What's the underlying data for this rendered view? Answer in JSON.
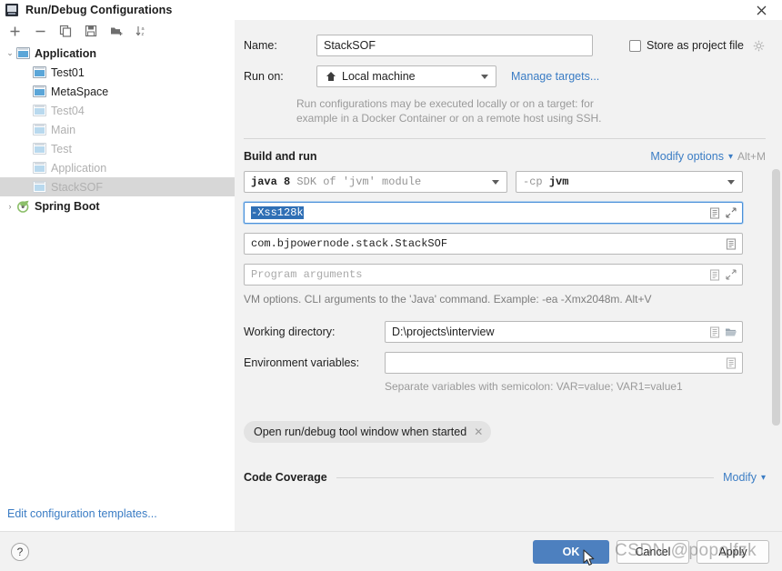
{
  "window": {
    "title": "Run/Debug Configurations",
    "app_icon": "intellij-idea-icon",
    "close_label": "✕"
  },
  "toolbar": {
    "add_label": "+",
    "remove_label": "−",
    "copy_label": "copy-configuration",
    "save_label": "save-configuration",
    "folder_label": "new-folder",
    "sort_label": "sort-configurations"
  },
  "tree": {
    "items": [
      {
        "label": "Application",
        "level": 0,
        "bold": true,
        "dim": false,
        "twisty": "⌄",
        "icon": "application-icon",
        "selected": false
      },
      {
        "label": "Test01",
        "level": 1,
        "bold": false,
        "dim": false,
        "twisty": "",
        "icon": "application-icon",
        "selected": false
      },
      {
        "label": "MetaSpace",
        "level": 1,
        "bold": false,
        "dim": false,
        "twisty": "",
        "icon": "application-icon",
        "selected": false
      },
      {
        "label": "Test04",
        "level": 1,
        "bold": false,
        "dim": true,
        "twisty": "",
        "icon": "application-icon",
        "selected": false
      },
      {
        "label": "Main",
        "level": 1,
        "bold": false,
        "dim": true,
        "twisty": "",
        "icon": "application-icon",
        "selected": false
      },
      {
        "label": "Test",
        "level": 1,
        "bold": false,
        "dim": true,
        "twisty": "",
        "icon": "application-icon",
        "selected": false
      },
      {
        "label": "Application",
        "level": 1,
        "bold": false,
        "dim": true,
        "twisty": "",
        "icon": "application-icon",
        "selected": false
      },
      {
        "label": "StackSOF",
        "level": 1,
        "bold": false,
        "dim": true,
        "twisty": "",
        "icon": "application-icon",
        "selected": true
      },
      {
        "label": "Spring Boot",
        "level": 0,
        "bold": true,
        "dim": false,
        "twisty": "›",
        "icon": "spring-boot-icon",
        "selected": false
      }
    ],
    "edit_templates_link": "Edit configuration templates..."
  },
  "form": {
    "name_label": "Name:",
    "name_value": "StackSOF",
    "store_as_project_file_label": "Store as project file",
    "store_as_project_file_checked": false,
    "store_gear_icon": "gear-icon",
    "run_on_label": "Run on:",
    "run_on_value": "Local machine",
    "run_on_icon": "home-icon",
    "manage_targets_link": "Manage targets...",
    "run_on_hint_line1": "Run configurations may be executed locally or on a target: for",
    "run_on_hint_line2": "example in a Docker Container or on a remote host using SSH.",
    "build_and_run_title": "Build and run",
    "modify_options_label": "Modify options",
    "modify_options_shortcut": "Alt+M",
    "jre_value_bold": "java 8",
    "jre_value_rest": "SDK of 'jvm' module",
    "cp_value_prefix": "-cp",
    "cp_value_module": "jvm",
    "vm_options_value": "-Xss128k",
    "vm_options_selected": true,
    "main_class_value": "com.bjpowernode.stack.StackSOF",
    "program_arguments_placeholder": "Program arguments",
    "vm_options_hint": "VM options. CLI arguments to the 'Java' command. Example: -ea -Xmx2048m. Alt+V",
    "working_directory_label": "Working directory:",
    "working_directory_value": "D:\\projects\\interview",
    "environment_variables_label": "Environment variables:",
    "environment_variables_value": "",
    "environment_variables_hint": "Separate variables with semicolon: VAR=value; VAR1=value1",
    "open_tool_window_chip": "Open run/debug tool window when started",
    "chip_close_label": "✕",
    "code_coverage_title": "Code Coverage",
    "code_coverage_modify_label": "Modify"
  },
  "footer": {
    "help_label": "?",
    "ok_label": "OK",
    "cancel_label": "Cancel",
    "apply_label": "Apply"
  },
  "watermark": {
    "text": "CSDN @popolfzk"
  },
  "colors": {
    "accent_blue": "#3a7cc4",
    "primary_button": "#4d80bf",
    "selection_blue": "#2f6fb5",
    "tree_selection": "#d7d7d7"
  }
}
